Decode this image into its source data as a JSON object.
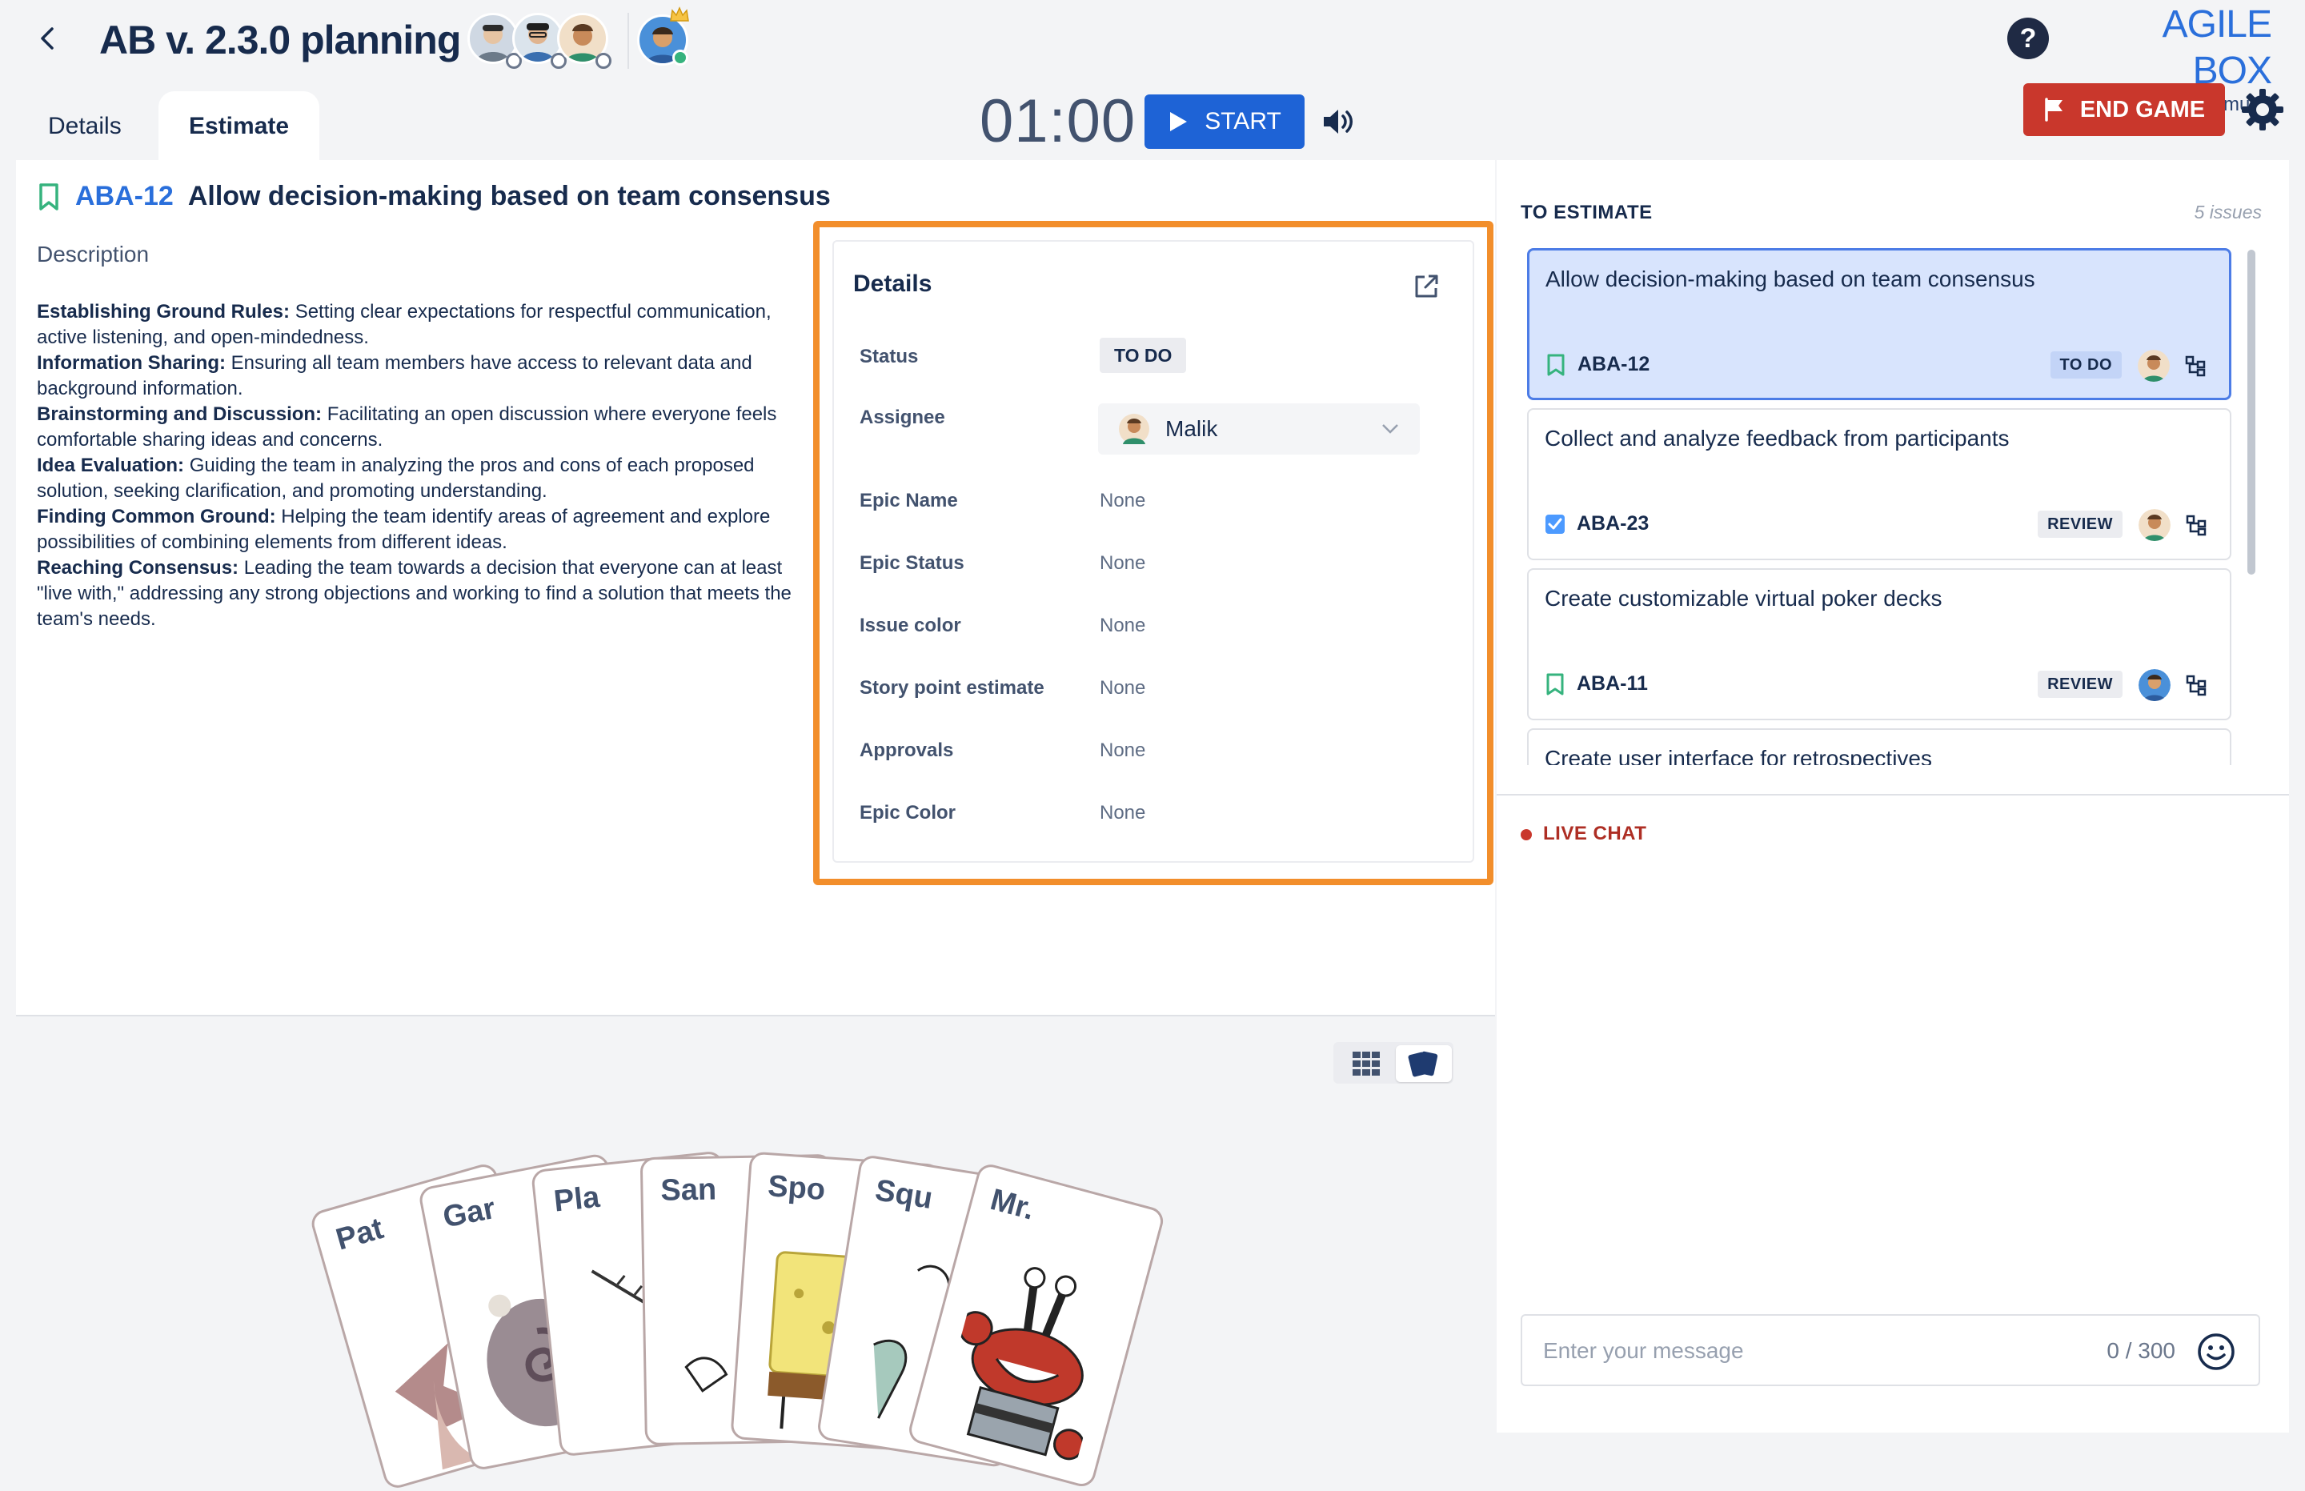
{
  "header": {
    "title": "AB v. 2.3.0 planning",
    "help_label": "?",
    "brand_name": "AGILE BOX",
    "brand_sub": "by DevSamurai"
  },
  "tabs": [
    {
      "label": "Details",
      "active": false
    },
    {
      "label": "Estimate",
      "active": true
    }
  ],
  "timer": {
    "display": "01:00",
    "start_label": "START"
  },
  "end_game_label": "END GAME",
  "issue": {
    "key": "ABA-12",
    "title": "Allow decision-making based on team consensus",
    "description_label": "Description",
    "description": [
      {
        "term": "Establishing Ground Rules:",
        "text": " Setting clear expectations for respectful communication, active listening, and open-mindedness."
      },
      {
        "term": "Information Sharing:",
        "text": " Ensuring all team members have access to relevant data and background information."
      },
      {
        "term": "Brainstorming and Discussion:",
        "text": " Facilitating an open discussion where everyone feels comfortable sharing ideas and concerns."
      },
      {
        "term": "Idea Evaluation:",
        "text": " Guiding the team in analyzing the pros and cons of each proposed solution, seeking clarification, and promoting understanding."
      },
      {
        "term": "Finding Common Ground:",
        "text": " Helping the team identify areas of agreement and explore possibilities of combining elements from different ideas."
      },
      {
        "term": "Reaching Consensus:",
        "text": " Leading the team towards a decision that everyone can at least \"live with,\" addressing any strong objections and working to find a solution that meets the team's needs."
      }
    ]
  },
  "details": {
    "title": "Details",
    "status_label": "Status",
    "status_value": "TO DO",
    "assignee_label": "Assignee",
    "assignee_value": "Malik",
    "fields": [
      {
        "label": "Epic Name",
        "value": "None"
      },
      {
        "label": "Epic Status",
        "value": "None"
      },
      {
        "label": "Issue color",
        "value": "None"
      },
      {
        "label": "Story point estimate",
        "value": "None"
      },
      {
        "label": "Approvals",
        "value": "None"
      },
      {
        "label": "Epic Color",
        "value": "None"
      }
    ]
  },
  "cards": [
    {
      "label": "Pat"
    },
    {
      "label": "Gar"
    },
    {
      "label": "Pla"
    },
    {
      "label": "San"
    },
    {
      "label": "Spo"
    },
    {
      "label": "Squ"
    },
    {
      "label": "Mr."
    }
  ],
  "to_estimate": {
    "title": "TO ESTIMATE",
    "count": "5 issues",
    "items": [
      {
        "title": "Allow decision-making based on team consensus",
        "key": "ABA-12",
        "status": "TO DO",
        "type": "story",
        "selected": true
      },
      {
        "title": "Collect and analyze feedback from participants",
        "key": "ABA-23",
        "status": "REVIEW",
        "type": "task",
        "selected": false
      },
      {
        "title": "Create customizable virtual poker decks",
        "key": "ABA-11",
        "status": "REVIEW",
        "type": "story",
        "selected": false
      },
      {
        "title": "Create user interface for retrospectives",
        "key": "",
        "status": "",
        "type": "story",
        "selected": false
      }
    ]
  },
  "chat": {
    "title": "LIVE CHAT",
    "placeholder": "Enter your message",
    "count": "0 / 300"
  },
  "colors": {
    "accent": "#1e63d6",
    "danger": "#c9372c",
    "highlight": "#f28e2b",
    "selected_bg": "#d8e4fd"
  }
}
